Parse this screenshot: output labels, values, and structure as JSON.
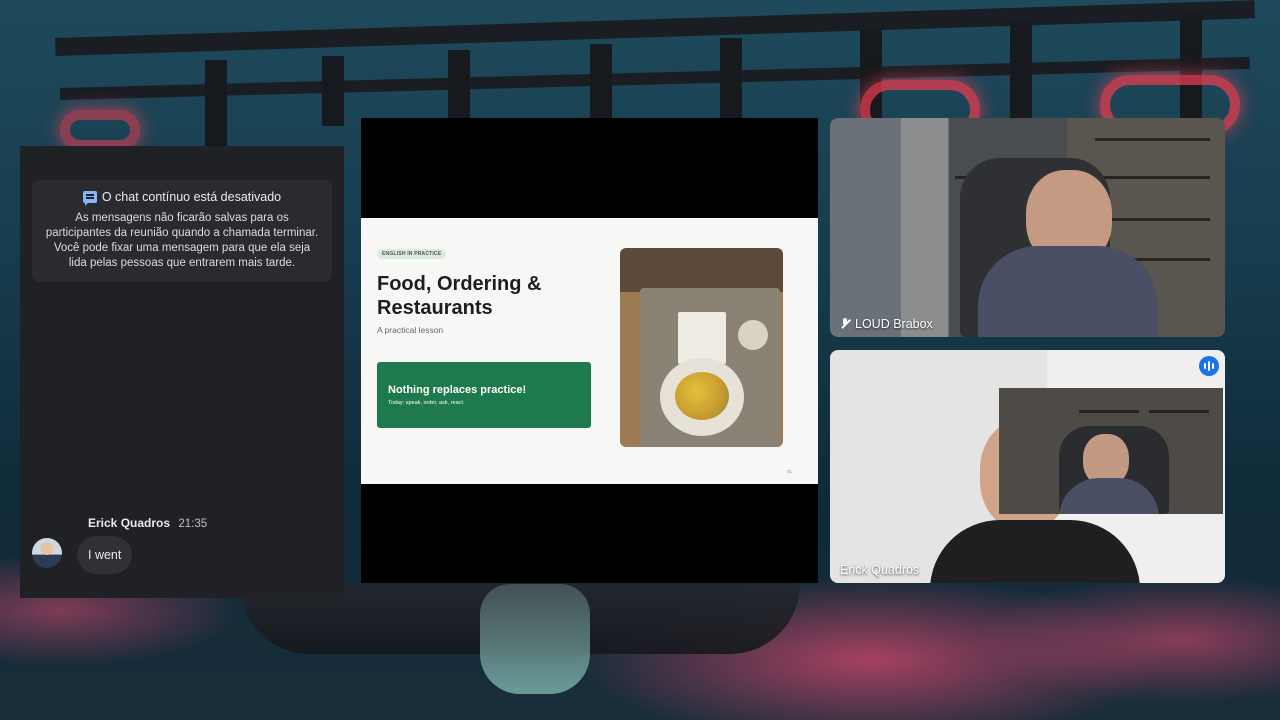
{
  "chat": {
    "notice_title": "O chat contínuo está desativado",
    "notice_body": "As mensagens não ficarão salvas para os participantes da reunião quando a chamada terminar. Você pode fixar uma mensagem para que ela seja lida pelas pessoas que entrarem mais tarde.",
    "messages": [
      {
        "sender": "Erick Quadros",
        "time": "21:35",
        "text": "I went"
      }
    ]
  },
  "slide": {
    "tag": "ENGLISH IN PRACTICE",
    "title": "Food, Ordering & Restaurants",
    "subtitle": "A practical lesson",
    "cta_title": "Nothing replaces practice!",
    "cta_subtitle": "Today: speak, order, ask, react.",
    "page_number": "01"
  },
  "participants": [
    {
      "name": "LOUD Brabox",
      "muted": true
    },
    {
      "name": "Erick Quadros",
      "speaking": true
    }
  ],
  "colors": {
    "chat_bg": "#202124",
    "slide_accent": "#1e7a4c",
    "speaking_indicator": "#1a73e8"
  },
  "icons": [
    "chat-icon",
    "mic-off-icon",
    "speaking-icon"
  ]
}
